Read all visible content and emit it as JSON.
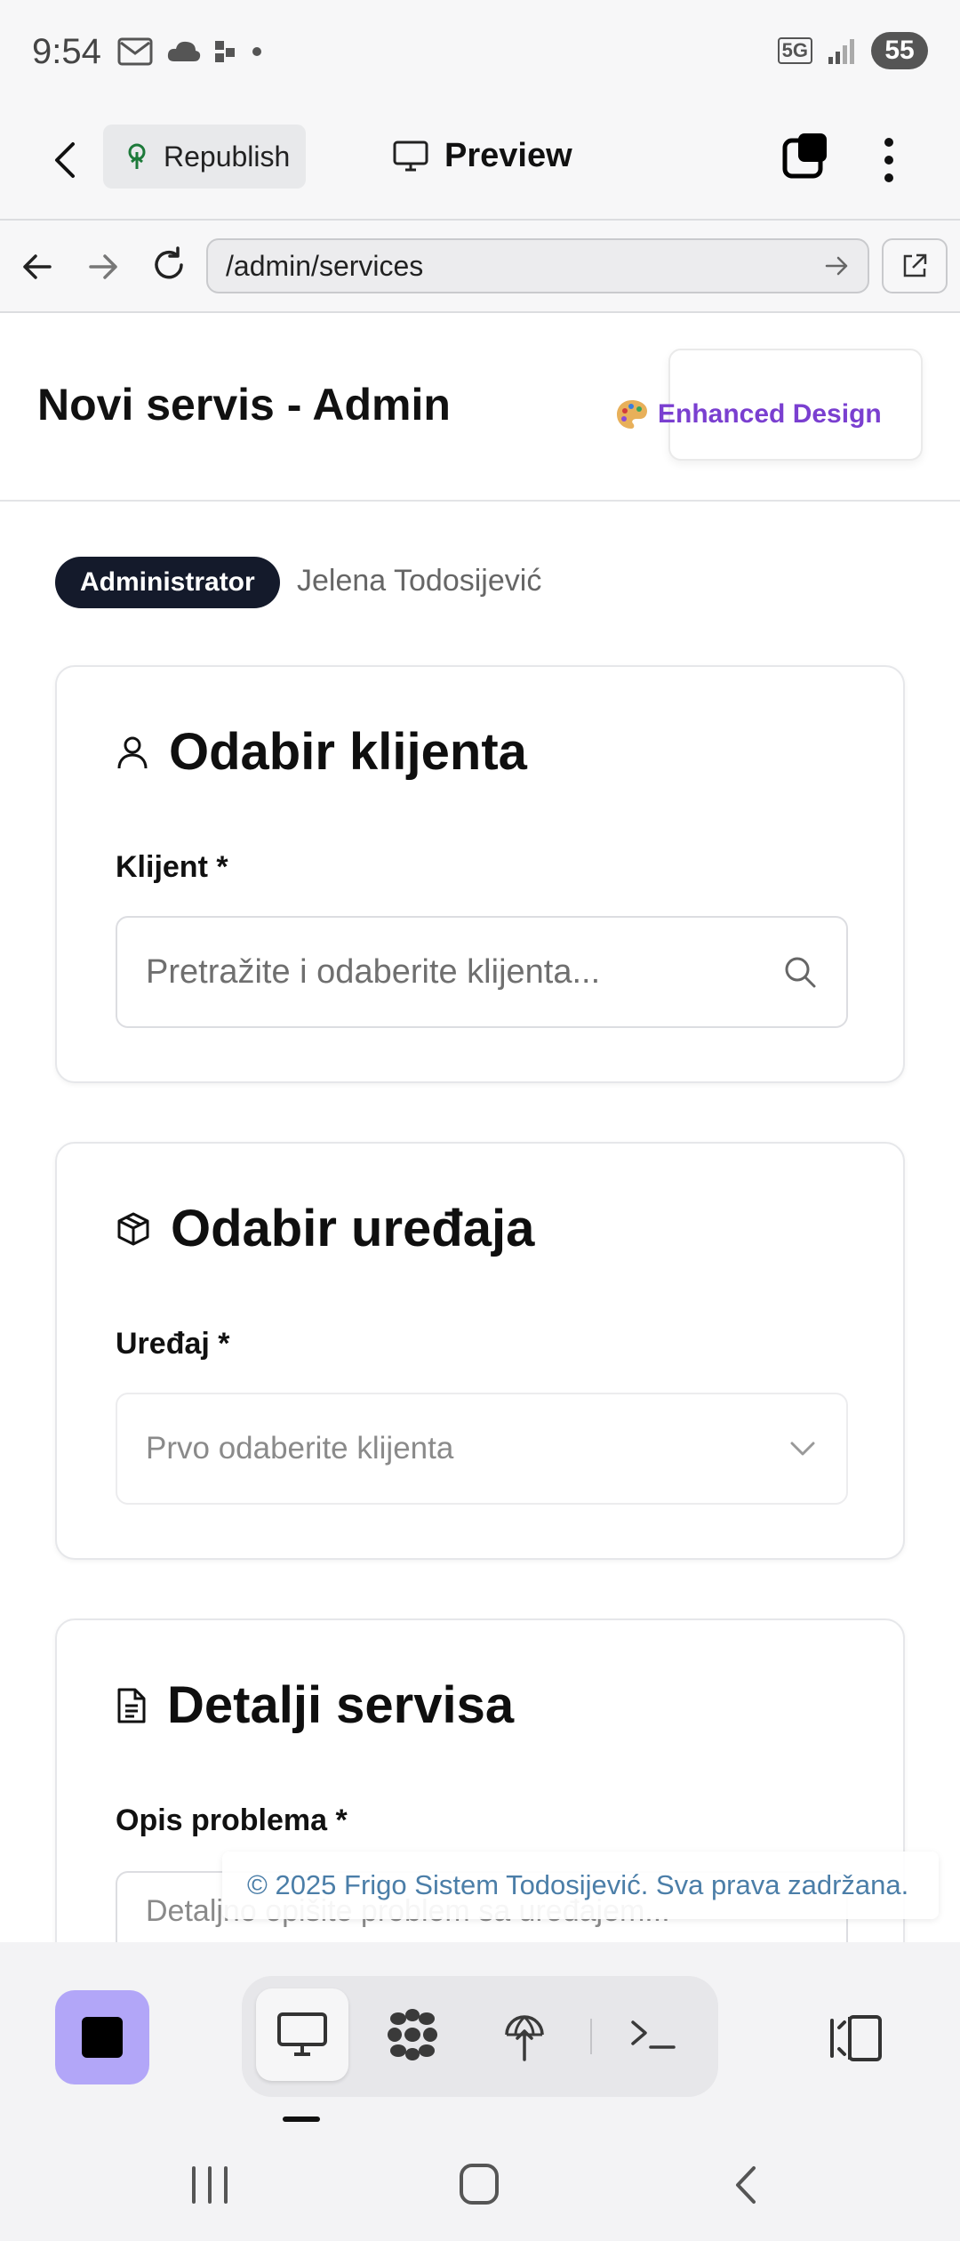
{
  "status_bar": {
    "time": "9:54",
    "network": "5G",
    "battery": "55"
  },
  "app_bar": {
    "republish_label": "Republish",
    "preview_label": "Preview"
  },
  "url_bar": {
    "url": "/admin/services"
  },
  "page": {
    "title": "Novi servis - Admin",
    "enhanced_design_label": "Enhanced Design",
    "role_badge": "Administrator",
    "user_name": "Jelena Todosijević"
  },
  "cards": {
    "client": {
      "title": "Odabir klijenta",
      "field_label": "Klijent *",
      "placeholder": "Pretražite i odaberite klijenta..."
    },
    "device": {
      "title": "Odabir uređaja",
      "field_label": "Uređaj *",
      "placeholder": "Prvo odaberite klijenta"
    },
    "details": {
      "title": "Detalji servisa",
      "field_label": "Opis problema *",
      "placeholder": "Detaljno opišite problem sa uređajem..."
    }
  },
  "footer": {
    "copyright": "© 2025 Frigo Sistem Todosijević. Sva prava zadržana."
  },
  "colors": {
    "accent_purple": "#7a3fd0",
    "badge_dark": "#141a2b",
    "footer_link": "#4b7ea8",
    "toolbar_square": "#b2a6f8"
  }
}
